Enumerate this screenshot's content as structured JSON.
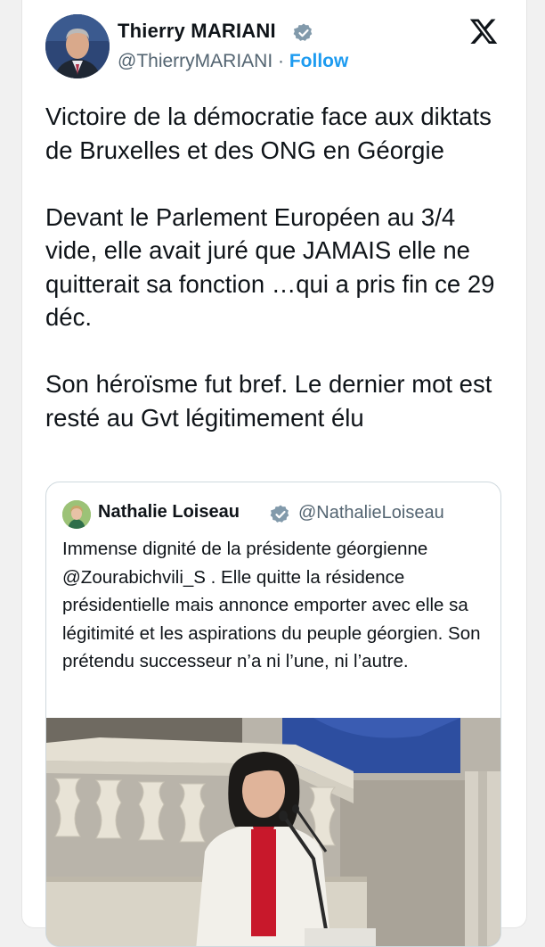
{
  "tweet": {
    "author_name": "Thierry MARIANI",
    "handle": "@ThierryMARIANI",
    "separator": " · ",
    "follow_label": "Follow",
    "text": "Victoire de la démocratie face aux diktats de Bruxelles et des ONG en Géorgie\n\nDevant le Parlement Européen au 3/4 vide, elle avait juré que JAMAIS elle ne quitterait sa fonction …qui a pris fin ce 29 déc.\n\nSon héroïsme fut bref. Le dernier mot est resté au Gvt légitimement élu",
    "verified": true
  },
  "quoted_tweet": {
    "author_name": "Nathalie Loiseau",
    "handle": "@NathalieLoiseau",
    "text": "Immense dignité de la présidente géorgienne @Zourabichvili_S . Elle quitte la résidence présidentielle mais annonce emporter avec elle sa légitimité et les aspirations du peuple géorgien. Son prétendu successeur n’a ni l’une, ni l’autre.",
    "verified": true,
    "media": "photo of a woman in a white jacket and red top speaking at a microphone on a stone balcony with balustrade, EU flag behind"
  },
  "icons": {
    "verified": "verified-badge-icon",
    "platform": "x-logo-icon"
  },
  "colors": {
    "link": "#1d9bf0",
    "secondary_text": "#536471",
    "primary_text": "#0f1419",
    "verified": "#829aab"
  }
}
